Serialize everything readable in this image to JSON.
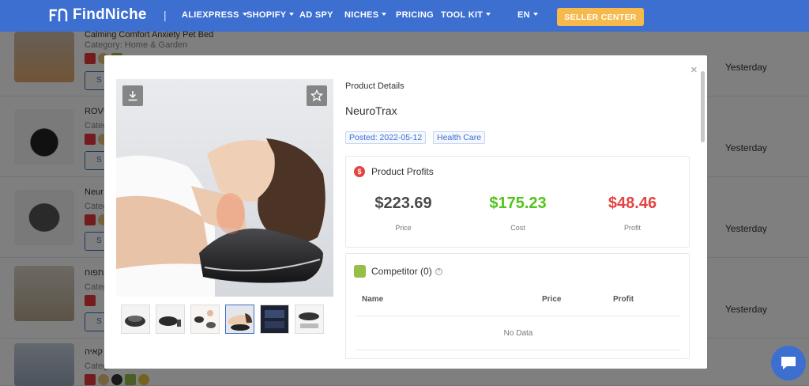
{
  "nav": {
    "logo_text": "FindNiche",
    "separator": "|",
    "items": [
      {
        "label": "ALIEXPRESS",
        "dropdown": true
      },
      {
        "label": "SHOPIFY",
        "dropdown": true
      },
      {
        "label": "AD SPY",
        "dropdown": false
      },
      {
        "label": "NICHES",
        "dropdown": true
      },
      {
        "label": "PRICING",
        "dropdown": false
      },
      {
        "label": "TOOL KIT",
        "dropdown": true
      }
    ],
    "language": "EN",
    "seller_center": "SELLER CENTER"
  },
  "background_list": [
    {
      "title": "Calming Comfort Anxiety Pet Bed",
      "category": "Category: Home & Garden",
      "date": "Yesterday"
    },
    {
      "title": "ROVU",
      "category": "Categ",
      "date": "Yesterday"
    },
    {
      "title": "Neur",
      "category": "Categ",
      "date": "Yesterday"
    },
    {
      "title": "תפוח",
      "category": "Categ",
      "date": "Yesterday"
    },
    {
      "title": "קאיה",
      "category": "Categ",
      "date": "Yesterday"
    }
  ],
  "modal": {
    "section_label": "Product Details",
    "product_name": "NeuroTrax",
    "posted": "Posted: 2022-05-12",
    "category_tag": "Health Care",
    "profits": {
      "title": "Product Profits",
      "badge": "$",
      "price": {
        "value": "$223.69",
        "label": "Price",
        "color": "#4a4a4a"
      },
      "cost": {
        "value": "$175.23",
        "label": "Cost",
        "color": "#52c41a"
      },
      "profit": {
        "value": "$48.46",
        "label": "Profit",
        "color": "#e54242"
      }
    },
    "competitor": {
      "title": "Competitor (0)",
      "help": "?",
      "columns": [
        "Name",
        "Price",
        "Profit"
      ],
      "empty_text": "No Data"
    },
    "close": "×"
  },
  "colors": {
    "brand": "#3d6fd1",
    "seller_btn": "#f6b94b"
  }
}
